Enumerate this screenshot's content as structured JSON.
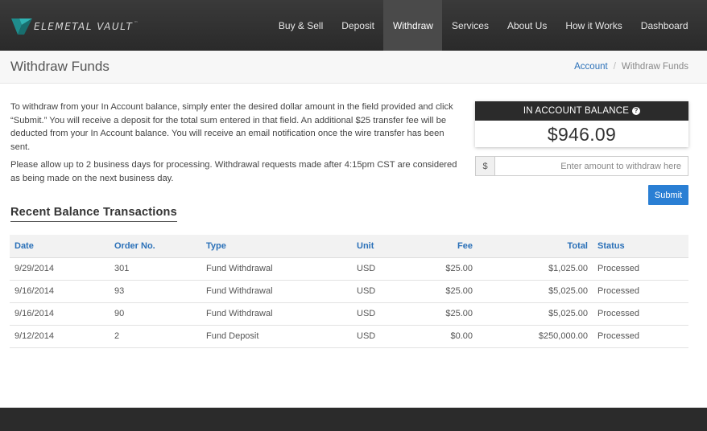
{
  "brand": {
    "logo_text": "ELEMETAL VAULT",
    "logo_tm": "™"
  },
  "nav": {
    "items": [
      {
        "label": "Buy & Sell"
      },
      {
        "label": "Deposit"
      },
      {
        "label": "Withdraw"
      },
      {
        "label": "Services"
      },
      {
        "label": "About Us"
      },
      {
        "label": "How it Works"
      },
      {
        "label": "Dashboard"
      }
    ],
    "active": "Withdraw"
  },
  "page": {
    "title": "Withdraw Funds",
    "breadcrumb": {
      "link": "Account",
      "separator": "/",
      "current": "Withdraw Funds"
    }
  },
  "intro": {
    "paragraph1": "To withdraw from your In Account balance, simply enter the desired dollar amount in the field provided and click “Submit.” You will receive a deposit for the total sum entered in that field. An additional $25 transfer fee will be deducted from your In Account balance. You will receive an email notification once the wire transfer has been sent.",
    "paragraph2": "Please allow up to 2 business days for processing. Withdrawal requests made after 4:15pm CST are considered as being made on the next business day."
  },
  "balance": {
    "heading": "IN ACCOUNT BALANCE",
    "help_icon": "question-icon",
    "amount": "$946.09"
  },
  "withdraw_form": {
    "currency_addon": "$",
    "value": "",
    "placeholder": "Enter amount to withdraw here",
    "submit_label": "Submit"
  },
  "transactions": {
    "heading": "Recent Balance Transactions",
    "columns": [
      "Date",
      "Order No.",
      "Type",
      "Unit",
      "Fee",
      "Total",
      "Status"
    ],
    "rows": [
      {
        "date": "9/29/2014",
        "order": "301",
        "type": "Fund Withdrawal",
        "unit": "USD",
        "fee": "$25.00",
        "total": "$1,025.00",
        "status": "Processed"
      },
      {
        "date": "9/16/2014",
        "order": "93",
        "type": "Fund Withdrawal",
        "unit": "USD",
        "fee": "$25.00",
        "total": "$5,025.00",
        "status": "Processed"
      },
      {
        "date": "9/16/2014",
        "order": "90",
        "type": "Fund Withdrawal",
        "unit": "USD",
        "fee": "$25.00",
        "total": "$5,025.00",
        "status": "Processed"
      },
      {
        "date": "9/12/2014",
        "order": "2",
        "type": "Fund Deposit",
        "unit": "USD",
        "fee": "$0.00",
        "total": "$250,000.00",
        "status": "Processed"
      }
    ]
  },
  "colors": {
    "navbar": "#2f2f2f",
    "accent_link": "#2a70b8",
    "submit_button": "#2a7fd4",
    "logo_teal": "#1fa6a6"
  }
}
